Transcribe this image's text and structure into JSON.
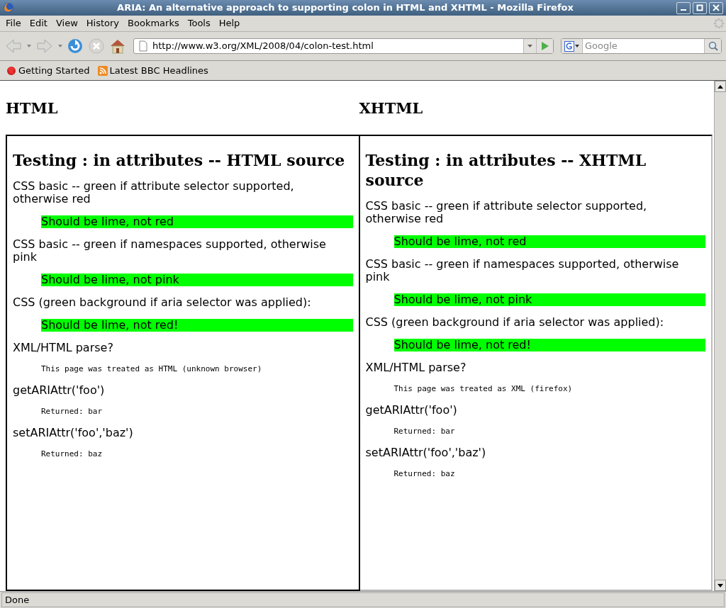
{
  "window": {
    "title": "ARIA: An alternative approach to supporting colon in HTML and XHTML - Mozilla Firefox"
  },
  "menu": [
    "File",
    "Edit",
    "View",
    "History",
    "Bookmarks",
    "Tools",
    "Help"
  ],
  "address": {
    "value": "http://www.w3.org/XML/2008/04/colon-test.html"
  },
  "search": {
    "placeholder": "Google"
  },
  "bookmarks": [
    {
      "label": "Getting Started",
      "kind": "app"
    },
    {
      "label": "Latest BBC Headlines",
      "kind": "feed"
    }
  ],
  "frames": [
    {
      "heading": "HTML",
      "title": "Testing : in attributes -- HTML source",
      "blocks": [
        {
          "kind": "label",
          "text": "CSS basic -- green if attribute selector supported, otherwise red"
        },
        {
          "kind": "highlight",
          "text": "Should be lime, not red"
        },
        {
          "kind": "label",
          "text": "CSS basic -- green if namespaces supported, otherwise pink"
        },
        {
          "kind": "highlight",
          "text": "Should be lime, not pink"
        },
        {
          "kind": "label",
          "text": "CSS (green background if aria selector was applied):"
        },
        {
          "kind": "highlight",
          "text": "Should be lime, not red!"
        },
        {
          "kind": "label",
          "text": "XML/HTML parse?"
        },
        {
          "kind": "output",
          "text": "This page was treated as HTML (unknown browser)"
        },
        {
          "kind": "label",
          "text": "getARIAttr('foo')"
        },
        {
          "kind": "output",
          "text": "Returned: bar"
        },
        {
          "kind": "label",
          "text": "setARIAttr('foo','baz')"
        },
        {
          "kind": "output",
          "text": "Returned: baz"
        }
      ]
    },
    {
      "heading": "XHTML",
      "title": "Testing : in attributes -- XHTML source",
      "blocks": [
        {
          "kind": "label",
          "text": "CSS basic -- green if attribute selector supported, otherwise red"
        },
        {
          "kind": "highlight",
          "text": "Should be lime, not red"
        },
        {
          "kind": "label",
          "text": "CSS basic -- green if namespaces supported, otherwise pink"
        },
        {
          "kind": "highlight",
          "text": "Should be lime, not pink"
        },
        {
          "kind": "label",
          "text": "CSS (green background if aria selector was applied):"
        },
        {
          "kind": "highlight",
          "text": "Should be lime, not red!"
        },
        {
          "kind": "label",
          "text": "XML/HTML parse?"
        },
        {
          "kind": "output",
          "text": "This page was treated as XML (firefox)"
        },
        {
          "kind": "label",
          "text": "getARIAttr('foo')"
        },
        {
          "kind": "output",
          "text": "Returned: bar"
        },
        {
          "kind": "label",
          "text": "setARIAttr('foo','baz')"
        },
        {
          "kind": "output",
          "text": "Returned: baz"
        }
      ]
    }
  ],
  "status_bar": "Done"
}
